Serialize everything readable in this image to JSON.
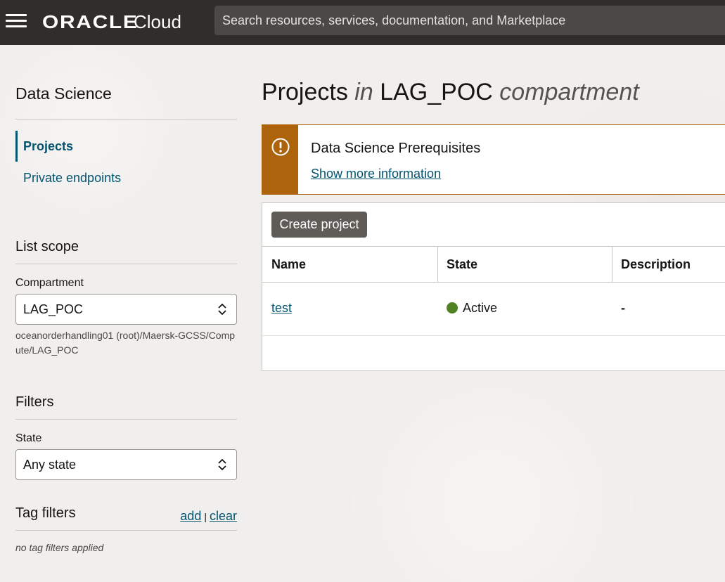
{
  "header": {
    "brand_name": "ORACLE",
    "brand_product": "Cloud",
    "search_placeholder": "Search resources, services, documentation, and Marketplace"
  },
  "sidebar": {
    "title": "Data Science",
    "nav": [
      {
        "label": "Projects",
        "active": true
      },
      {
        "label": "Private endpoints",
        "active": false
      }
    ],
    "list_scope": {
      "title": "List scope",
      "compartment_label": "Compartment",
      "compartment_value": "LAG_POC",
      "compartment_path": "oceanorderhandling01 (root)/Maersk-GCSS/Compute/LAG_POC"
    },
    "filters": {
      "title": "Filters",
      "state_label": "State",
      "state_value": "Any state"
    },
    "tag_filters": {
      "title": "Tag filters",
      "add_label": "add",
      "separator": "|",
      "clear_label": "clear",
      "empty_note": "no tag filters applied"
    }
  },
  "main": {
    "title_prefix": "Projects",
    "title_in": "in",
    "title_compartment": "LAG_POC",
    "title_suffix": "compartment",
    "alert": {
      "title": "Data Science Prerequisites",
      "link": "Show more information",
      "accent_color": "#ac630c"
    },
    "create_button": "Create project",
    "table": {
      "columns": [
        "Name",
        "State",
        "Description"
      ],
      "rows": [
        {
          "name": "test",
          "state": "Active",
          "state_color": "#508223",
          "description": "-"
        }
      ]
    }
  },
  "colors": {
    "header_bg": "#312d2a",
    "link": "#04536f",
    "page_bg": "#f1efed"
  }
}
